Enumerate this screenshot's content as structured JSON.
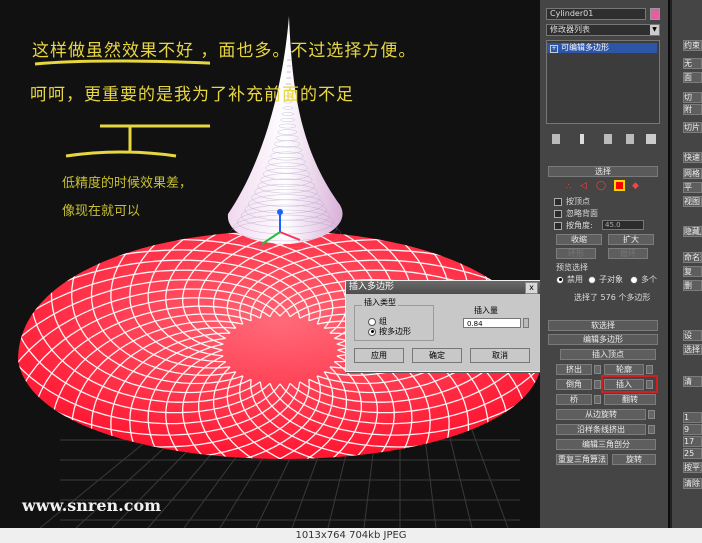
{
  "notes": {
    "line1": "这样做虽然效果不好  ，面也多。不过选择方便。",
    "line2": "呵呵，更重要的是我为了补充前面的不足",
    "small1": "低精度的时候效果差，",
    "small2": "像现在就可以"
  },
  "watermark": "www.snren.com",
  "dialog": {
    "title": "插入多边形",
    "group_label": "插入类型",
    "radio_group": "组",
    "radio_polygon": "按多边形",
    "amount_label": "插入量",
    "amount_value": "0.84",
    "apply": "应用",
    "ok": "确定",
    "cancel": "取消",
    "close": "x"
  },
  "modifier": {
    "object_name": "Cylinder01",
    "list_label": "修改器列表",
    "stack_item": "可编辑多边形",
    "name_color": "#e060a0"
  },
  "selection": {
    "title": "选择",
    "by_vertex": "按顶点",
    "ignore_back": "忽略背面",
    "by_angle": "按角度:",
    "angle_value": "45.0",
    "shrink": "收缩",
    "grow": "扩大",
    "ring": "环形",
    "loop": "循环",
    "preview": "预览选择",
    "preview_off": "禁用",
    "preview_sub": "子对象",
    "preview_multi": "多个",
    "status": "选择了 576 个多边形"
  },
  "soft_selection": {
    "title": "软选择"
  },
  "edit_polygons": {
    "title": "编辑多边形",
    "insert_vertex": "插入顶点",
    "extrude": "挤出",
    "outline": "轮廓",
    "bevel": "倒角",
    "inset": "插入",
    "bridge": "桥",
    "flip": "翻转",
    "hinge": "从边旋转",
    "extrude_spline": "沿样条线挤出",
    "edit_tri": "编辑三角剖分",
    "retri": "重复三角算法",
    "turn": "旋转"
  },
  "far_panel": {
    "items": [
      "约束",
      "无",
      "面",
      "切",
      "附",
      "切片",
      "快速",
      "网格",
      "平",
      "视图",
      "隐藏成",
      "命名选",
      "复",
      "删",
      "设",
      "选择",
      "清",
      "1",
      "9",
      "17",
      "25",
      "按平滑",
      "清除"
    ]
  },
  "statusbar": "1013x764  704kb  JPEG",
  "colors": {
    "cone": "#ff2a3a",
    "highlight": "#d83030",
    "note": "#e8d640"
  }
}
